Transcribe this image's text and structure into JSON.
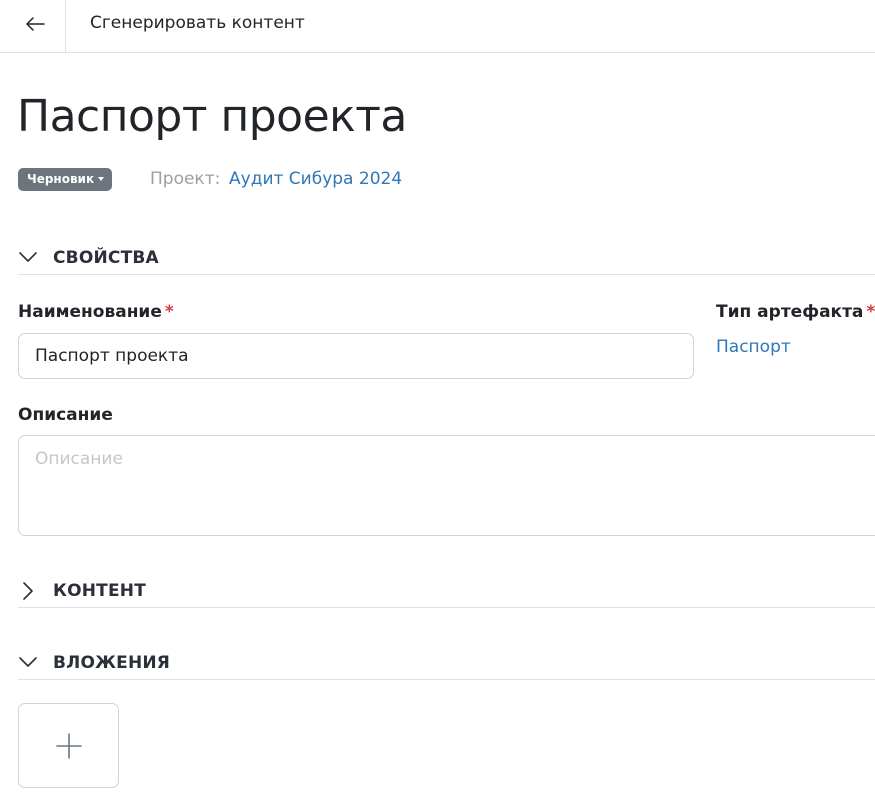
{
  "topbar": {
    "back_icon": "arrow-left-icon",
    "title": "Сгенерировать контент"
  },
  "page": {
    "title": "Паспорт проекта",
    "status_label": "Черновик",
    "project_label": "Проект:",
    "project_name": "Аудит Сибура 2024"
  },
  "sections": {
    "properties": {
      "title": "СВОЙСТВА",
      "expanded": true
    },
    "content": {
      "title": "КОНТЕНТ",
      "expanded": false
    },
    "attachments": {
      "title": "ВЛОЖЕНИЯ",
      "expanded": true
    }
  },
  "form": {
    "name_label": "Наименование",
    "name_value": "Паспорт проекта",
    "artifact_type_label": "Тип артефакта",
    "artifact_type_value": "Паспорт",
    "description_label": "Описание",
    "description_placeholder": "Описание",
    "required_marker": "*"
  },
  "attachments": {
    "add_icon": "plus-icon"
  },
  "colors": {
    "link": "#2e77b8",
    "badge": "#6c757d",
    "required": "#dc3545",
    "border": "#dee2e6"
  }
}
